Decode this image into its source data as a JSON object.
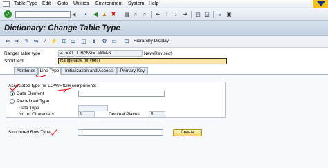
{
  "menubar": {
    "items": [
      "Table Type",
      "Edit",
      "Goto",
      "Utilities",
      "Environment",
      "System",
      "Help"
    ]
  },
  "toolbar": {
    "icons": [
      "enter-icon",
      "save-icon",
      "back-icon",
      "exit-icon",
      "cancel-icon",
      "print-icon",
      "find-icon",
      "find-next-icon",
      "first-page-icon",
      "prev-page-icon",
      "next-page-icon",
      "last-page-icon",
      "new-session-icon",
      "shortcut-icon",
      "help-icon",
      "layout-icon"
    ]
  },
  "title": "Dictionary: Change Table Type",
  "app_toolbar": {
    "hierarchy_label": "Hierarchy Display"
  },
  "header": {
    "ranges_label": "Ranges table type",
    "ranges_value": "ZTEST_T_RANGE_VBELN",
    "status_value": "New(Revised)",
    "short_text_label": "Short text",
    "short_text_value": "Range table for vbeln"
  },
  "tabs": [
    {
      "label": "Attributes",
      "active": false
    },
    {
      "label": "Line Type",
      "active": true
    },
    {
      "label": "Initialization and Access",
      "active": false
    },
    {
      "label": "Primary Key",
      "active": false
    }
  ],
  "line_type": {
    "group_title": "Associated type for LOW/HIGH components",
    "data_element_label": "Data Element",
    "data_element_selected": true,
    "data_element_value": "",
    "predefined_label": "Predefined Type",
    "data_type_label": "Data Type",
    "data_type_value": "",
    "no_chars_label": "No. of Characters",
    "no_chars_value": "0",
    "decimal_label": "Decimal Places",
    "decimal_value": "0",
    "structured_label": "Structured Row Type",
    "structured_value": "",
    "create_label": "Create"
  },
  "colors": {
    "title_bg": "#c4d1e1",
    "required_field": "#fbe6a6",
    "annotation": "#e00000"
  }
}
